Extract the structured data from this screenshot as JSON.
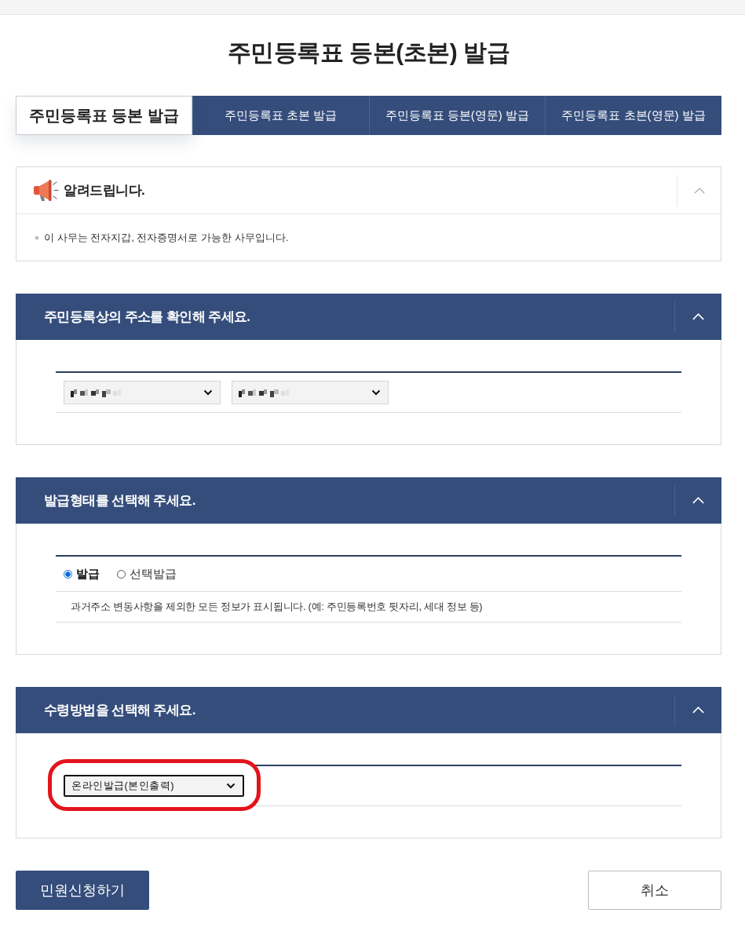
{
  "page_title": "주민등록표 등본(초본) 발급",
  "tabs": [
    {
      "label": "주민등록표 등본 발급",
      "selected": true
    },
    {
      "label": "주민등록표 초본 발급",
      "selected": false
    },
    {
      "label": "주민등록표 등본(영문) 발급",
      "selected": false
    },
    {
      "label": "주민등록표 초본(영문) 발급",
      "selected": false
    }
  ],
  "notice": {
    "title": "알려드립니다.",
    "expanded": true,
    "items": [
      "이 사무는 전자지갑, 전자증명서로 가능한 사무입니다."
    ]
  },
  "sections": [
    {
      "title": "주민등록상의 주소를 확인해 주세요.",
      "expanded": true,
      "rows": [
        {
          "kind": "selects",
          "selects": [
            {
              "redacted": true,
              "focused": false
            },
            {
              "redacted": true,
              "focused": false
            }
          ]
        }
      ]
    },
    {
      "title": "발급형태를 선택해 주세요.",
      "expanded": true,
      "rows": [
        {
          "kind": "radios",
          "options": [
            {
              "label": "발급",
              "selected": true
            },
            {
              "label": "선택발급",
              "selected": false
            }
          ]
        },
        {
          "kind": "text",
          "text": "과거주소 변동사항을 제외한 모든 정보가 표시됩니다. (예: 주민등록번호 뒷자리, 세대 정보 등)"
        }
      ]
    },
    {
      "title": "수령방법을 선택해 주세요.",
      "expanded": true,
      "rows": [
        {
          "kind": "selects",
          "selects": [
            {
              "value": "온라인발급(본인출력)",
              "redacted": false,
              "focused": true,
              "highlighted": true
            }
          ]
        }
      ]
    }
  ],
  "buttons": [
    {
      "label": "민원신청하기",
      "kind": "primary"
    },
    {
      "label": "취소",
      "kind": "secondary"
    }
  ]
}
